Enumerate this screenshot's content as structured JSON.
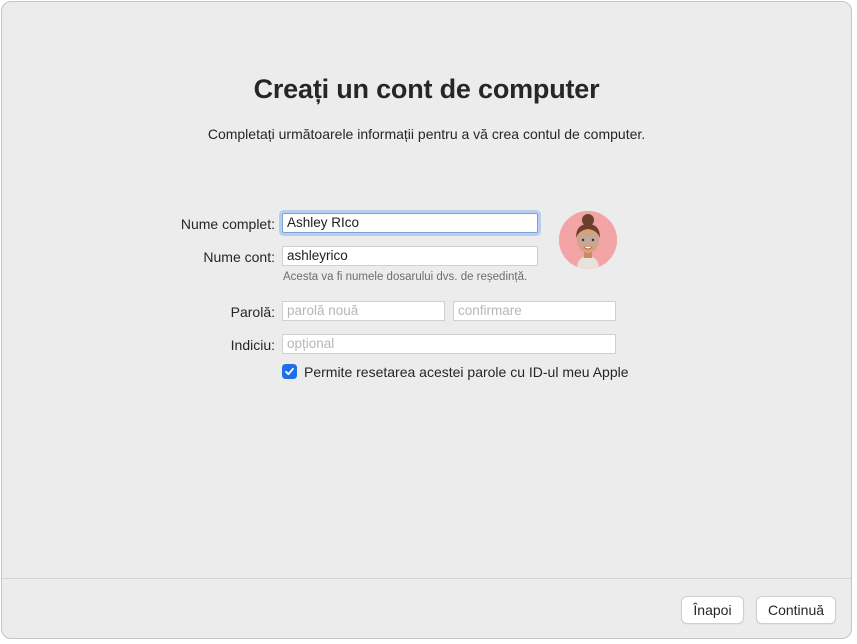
{
  "header": {
    "title": "Creați un cont de computer",
    "subtitle": "Completați următoarele informații pentru a vă crea contul de computer."
  },
  "form": {
    "full_name": {
      "label": "Nume complet:",
      "value": "Ashley RIco"
    },
    "account_name": {
      "label": "Nume cont:",
      "value": "ashleyrico",
      "hint": "Acesta va fi numele dosarului dvs. de reședință."
    },
    "password": {
      "label": "Parolă:",
      "placeholder": "parolă nouă",
      "confirm_placeholder": "confirmare"
    },
    "hint_field": {
      "label": "Indiciu:",
      "placeholder": "opțional"
    },
    "apple_id_reset": {
      "label": "Permite resetarea acestei parole cu ID-ul meu Apple",
      "checked": true
    }
  },
  "avatar": {
    "icon": "memoji-avatar",
    "background": "#f3a4a7"
  },
  "footer": {
    "back_label": "Înapoi",
    "continue_label": "Continuă"
  },
  "colors": {
    "accent": "#1f6fe8",
    "focus_ring": "#b9cdee",
    "window_bg": "#ececec"
  }
}
